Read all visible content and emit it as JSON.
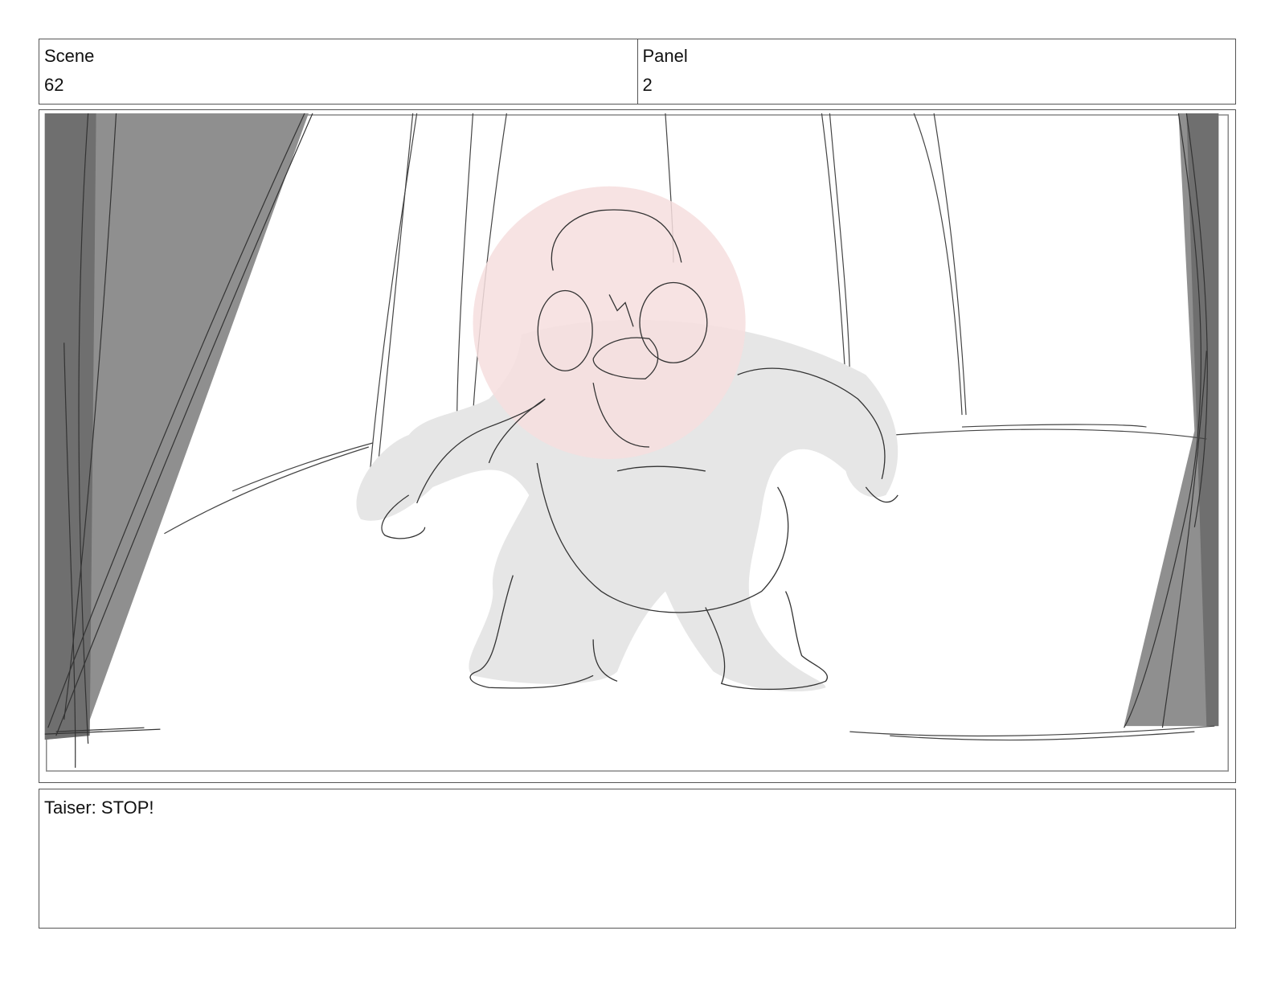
{
  "header": {
    "scene_label": "Scene",
    "scene_value": "62",
    "panel_label": "Panel",
    "panel_value": "2"
  },
  "notes": {
    "dialogue": "Taiser: STOP!"
  },
  "colors": {
    "curtain": "#8f8f8f",
    "curtain_dark": "#6f6f6f",
    "body_fill": "#e6e6e6",
    "head_highlight": "#f6dede",
    "line": "#333333"
  }
}
